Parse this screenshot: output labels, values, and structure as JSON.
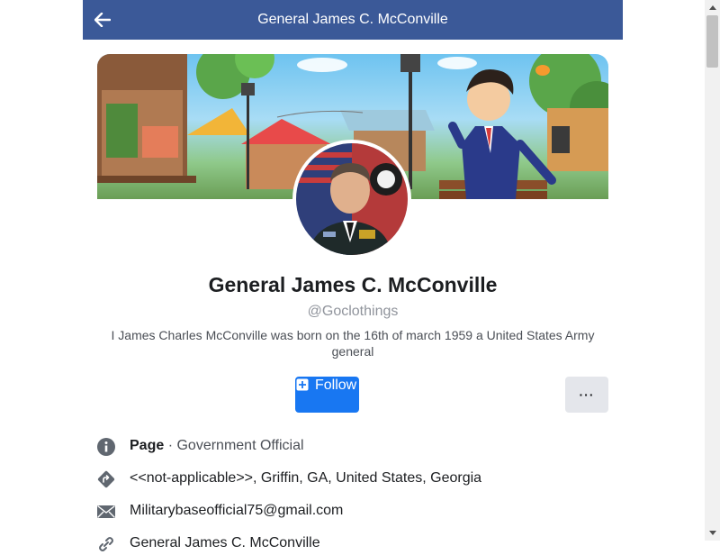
{
  "header": {
    "title": "General James C. McConville"
  },
  "profile": {
    "name": "General James C. McConville",
    "handle": "@Goclothings",
    "bio": "I James Charles McConville was born on the 16th of march 1959 a United States Army general"
  },
  "actions": {
    "follow_label": "Follow",
    "more_label": "···"
  },
  "info": {
    "category_type": "Page",
    "category_separator": " · ",
    "category_value": "Government Official",
    "address": "<<not-applicable>>, Griffin, GA, United States, Georgia",
    "email": "Militarybaseofficial75@gmail.com",
    "partial_row": "General James C. McConville"
  },
  "colors": {
    "header_bg": "#3b5998",
    "follow_bg": "#1877f2",
    "more_bg": "#e4e6eb",
    "icon": "#606770"
  },
  "icons": [
    "back-arrow-icon",
    "info-icon",
    "directions-icon",
    "envelope-icon",
    "link-icon",
    "plus-icon"
  ]
}
